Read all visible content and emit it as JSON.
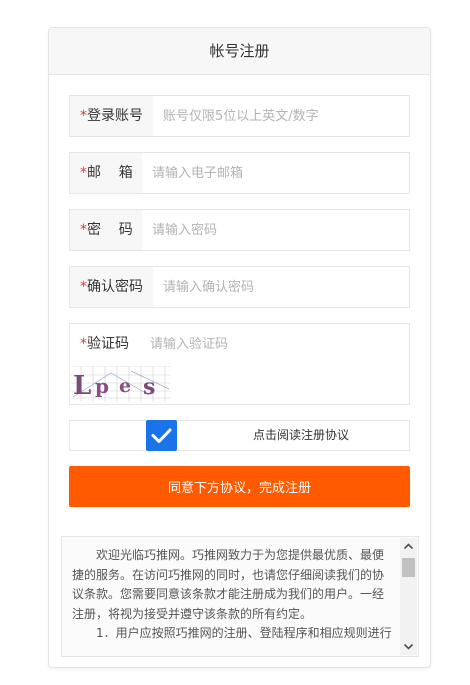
{
  "header": {
    "title": "帐号注册"
  },
  "form": {
    "required_mark": "*",
    "account": {
      "label": "登录账号",
      "placeholder": "账号仅限5位以上英文/数字",
      "value": ""
    },
    "email": {
      "label": "邮    箱",
      "placeholder": "请输入电子邮箱",
      "value": ""
    },
    "password": {
      "label": "密    码",
      "placeholder": "请输入密码",
      "value": ""
    },
    "confirm": {
      "label": "确认密码",
      "placeholder": "请输入确认密码",
      "value": ""
    },
    "captcha": {
      "label": "验证码",
      "placeholder": "请输入验证码",
      "value": "",
      "image_text": "Lpes"
    }
  },
  "agreement": {
    "checked": true,
    "label": "点击阅读注册协议"
  },
  "submit": {
    "label": "同意下方协议，完成注册"
  },
  "terms": {
    "paragraph1": "欢迎光临巧推网。巧推网致力于为您提供最优质、最便捷的服务。在访问巧推网的同时，也请您仔细阅读我们的协议条款。您需要同意该条款才能注册成为我们的用户。一经注册，将视为接受并遵守该条款的所有约定。",
    "paragraph2": "1．用户应按照巧推网的注册、登陆程序和相应规则进行"
  },
  "colors": {
    "accent": "#ff5a00",
    "checkbox": "#1a73e8",
    "required": "#e4393c"
  }
}
